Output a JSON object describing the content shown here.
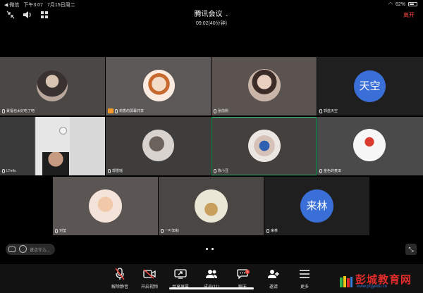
{
  "status_bar": {
    "carrier": "◀ 微信",
    "time": "下午3:07",
    "date": "7月15日周二",
    "battery": "62%",
    "battery_level": 0.62
  },
  "header": {
    "title": "腾讯会议",
    "duration": "09:02(40分钟)",
    "leave_label": "离开"
  },
  "participants": [
    {
      "name": "景福也太好吃了吧",
      "avatar_type": "photo",
      "bg": "#4a4744"
    },
    {
      "name": "莉香的屏幕共享",
      "avatar_type": "photo",
      "bg": "#5b5857",
      "sharing": true
    },
    {
      "name": "张前熙",
      "avatar_type": "photo",
      "bg": "#5a5350"
    },
    {
      "name": "郭蓝天空",
      "avatar_type": "letters",
      "letters": "天空",
      "bg": "#1f1f1f"
    },
    {
      "name": "LTmfs",
      "avatar_type": "camera",
      "bg": "#3a3a3a"
    },
    {
      "name": "郭雪瑶",
      "avatar_type": "photo",
      "bg": "#3e3d3c"
    },
    {
      "name": "陈小豆",
      "avatar_type": "photo",
      "bg": "#43403e",
      "active": true
    },
    {
      "name": "金色的麦田",
      "avatar_type": "photo",
      "bg": "#4a4a4a"
    },
    {
      "name": "刘莹",
      "avatar_type": "photo",
      "bg": "#5b5554"
    },
    {
      "name": "一叶知秋",
      "avatar_type": "photo",
      "bg": "#494643"
    },
    {
      "name": "来林",
      "avatar_type": "letters",
      "letters": "来林",
      "bg": "#1f1f1f"
    }
  ],
  "chat": {
    "placeholder": "说点什么..."
  },
  "toolbar": [
    {
      "label": "解除静音",
      "icon": "mic-off-icon"
    },
    {
      "label": "开启视频",
      "icon": "video-off-icon"
    },
    {
      "label": "共享屏幕",
      "icon": "share-screen-icon"
    },
    {
      "label": "成员(11)",
      "icon": "members-icon"
    },
    {
      "label": "聊天",
      "icon": "chat-icon",
      "badge": "1"
    },
    {
      "label": "邀请",
      "icon": "invite-icon"
    },
    {
      "label": "更多",
      "icon": "more-icon"
    }
  ],
  "watermark": {
    "text": "彭城教育网",
    "url": "www.pcjyedu.cn"
  }
}
